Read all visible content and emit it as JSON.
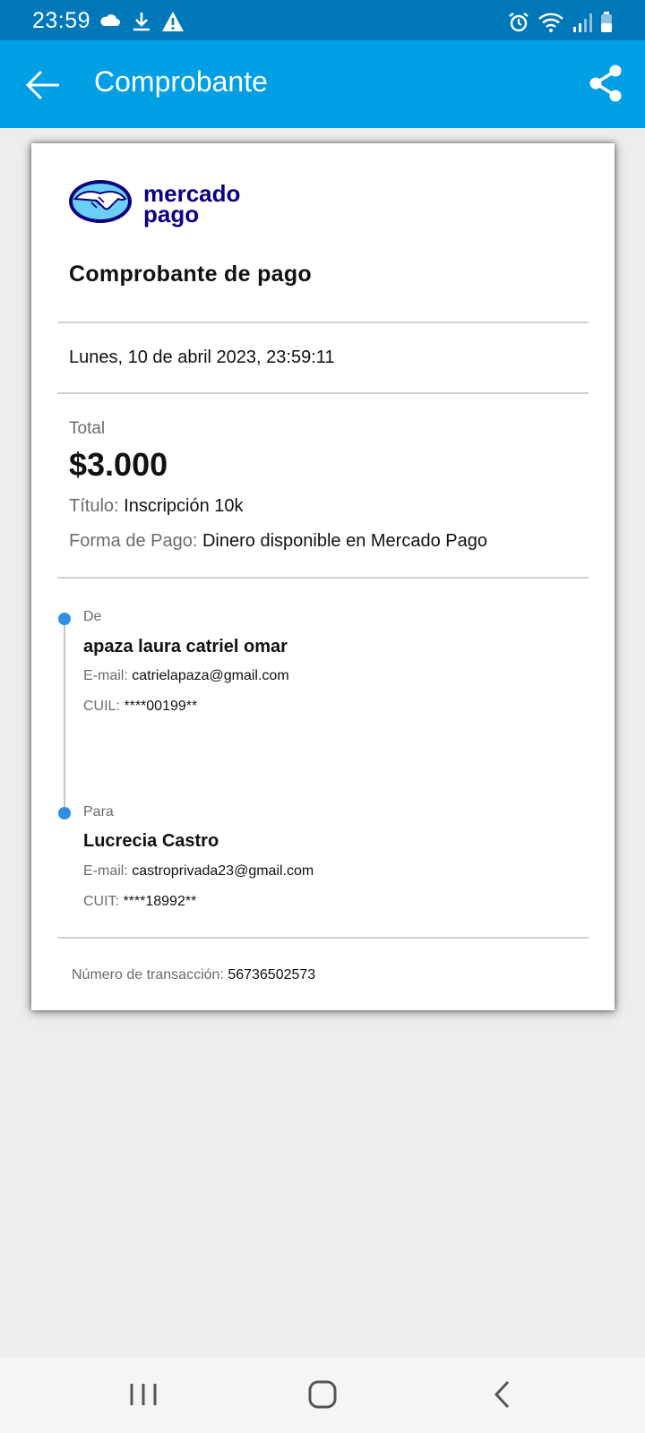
{
  "status_bar": {
    "time": "23:59",
    "left_icons": [
      "cloud-icon",
      "download-icon",
      "warning-icon"
    ],
    "right_icons": [
      "alarm-icon",
      "wifi-icon",
      "signal-icon",
      "battery-icon"
    ]
  },
  "app_bar": {
    "title": "Comprobante",
    "background": "#009ee3"
  },
  "receipt": {
    "logo_text_line1": "mercado",
    "logo_text_line2": "pago",
    "title": "Comprobante de pago",
    "date": "Lunes, 10 de abril 2023, 23:59:11",
    "total_label": "Total",
    "total_amount": "$3.000",
    "titulo_label": "Título:",
    "titulo_value": "Inscripción 10k",
    "forma_label": "Forma de Pago:",
    "forma_value": "Dinero disponible en Mercado Pago",
    "from": {
      "role": "De",
      "name": "apaza laura catriel omar",
      "email_label": "E-mail:",
      "email": "catrielapaza@gmail.com",
      "id_label": "CUIL:",
      "id_value": "****00199**"
    },
    "to": {
      "role": "Para",
      "name": "Lucrecia Castro",
      "email_label": "E-mail:",
      "email": "castroprivada23@gmail.com",
      "id_label": "CUIT:",
      "id_value": "****18992**"
    },
    "transaction_label": "Número de transacción:",
    "transaction_number": "56736502573",
    "accent": "#2d8fe6"
  },
  "nav_bar": {
    "icons": [
      "recent-apps-icon",
      "home-icon",
      "back-icon"
    ]
  }
}
